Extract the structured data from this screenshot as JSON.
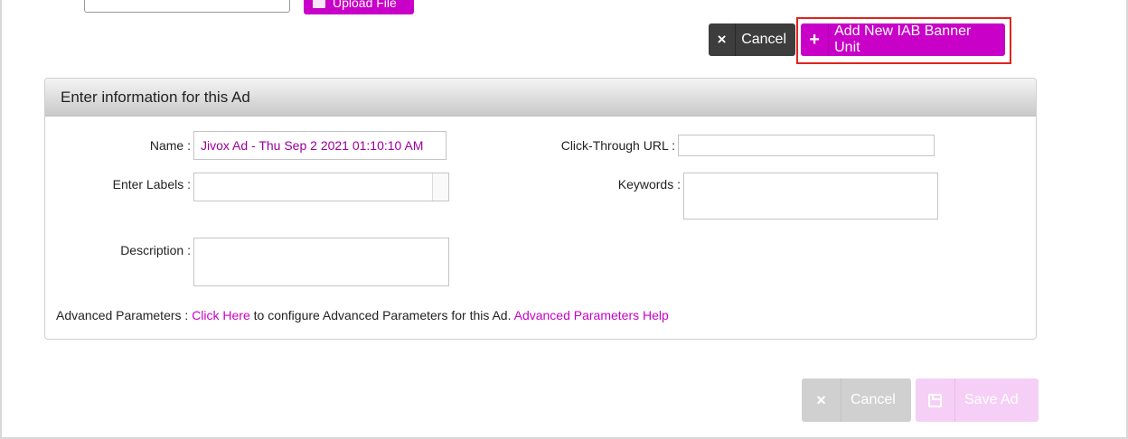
{
  "top": {
    "upload_label": "Upload File"
  },
  "actions": {
    "cancel_label": "Cancel",
    "add_iab_label": "Add New IAB Banner Unit"
  },
  "panel": {
    "title": "Enter information for this Ad",
    "name_label": "Name :",
    "name_value": "Jivox Ad - Thu Sep 2 2021 01:10:10 AM",
    "labels_label": "Enter Labels :",
    "labels_value": "",
    "description_label": "Description :",
    "description_value": "",
    "click_url_label": "Click-Through URL :",
    "click_url_value": "",
    "keywords_label": "Keywords :",
    "keywords_value": "",
    "advanced": {
      "label": "Advanced Parameters :",
      "link_text": "Click Here",
      "middle_text": " to configure Advanced Parameters for this Ad. ",
      "help_link": "Advanced Parameters Help"
    }
  },
  "footer": {
    "cancel_label": "Cancel",
    "save_label": "Save Ad"
  },
  "icons": {
    "cancel": "×",
    "add": "+"
  },
  "colors": {
    "accent": "#c800c8",
    "dark_button": "#3d3d3d",
    "highlight_border": "#e0231b"
  }
}
